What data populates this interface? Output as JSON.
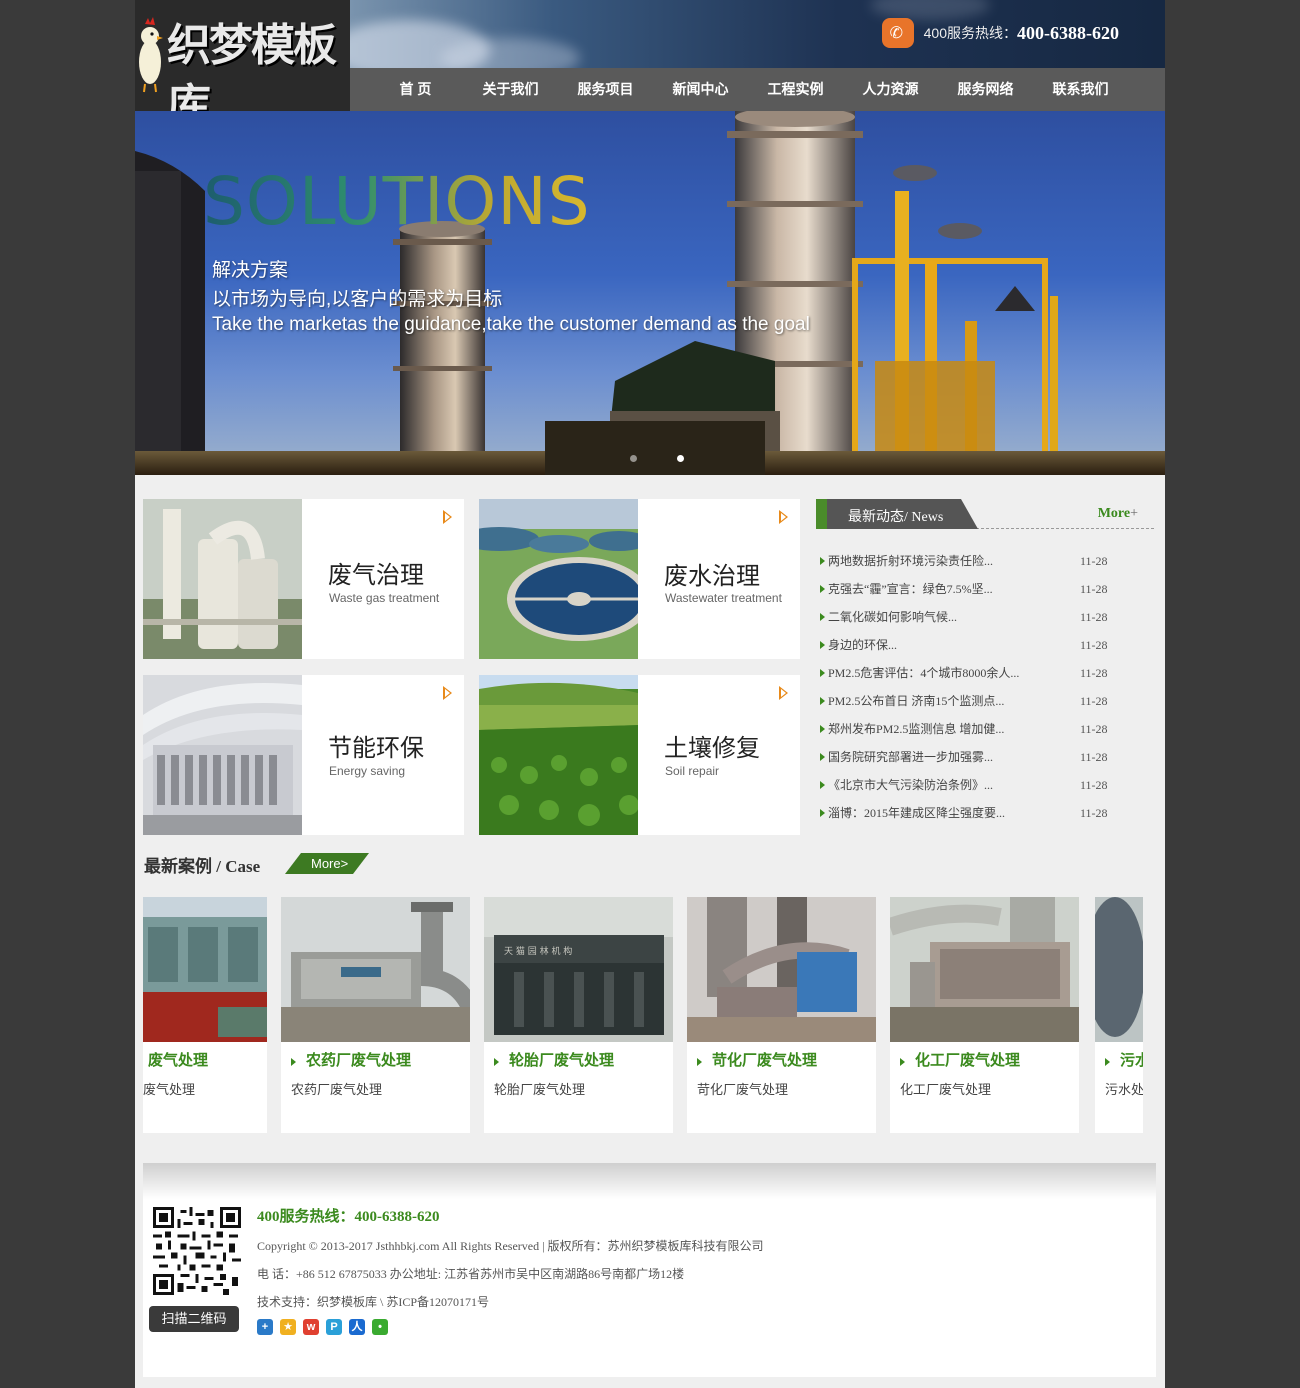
{
  "header": {
    "logo_text": "织梦模板库",
    "hotline_label": "400服务热线：",
    "hotline_number": "400-6388-620"
  },
  "nav": [
    {
      "label": "首 页"
    },
    {
      "label": "关于我们"
    },
    {
      "label": "服务项目"
    },
    {
      "label": "新闻中心"
    },
    {
      "label": "工程实例"
    },
    {
      "label": "人力资源"
    },
    {
      "label": "服务网络"
    },
    {
      "label": "联系我们"
    }
  ],
  "banner": {
    "title": "SOLUTIONS",
    "line1": "解决方案",
    "line2": "以市场为导向,以客户的需求为目标",
    "line3": "Take the marketas the guidance,take the customer demand as the goal",
    "active_slide": 2,
    "slide_count": 2
  },
  "services": [
    {
      "zh": "废气治理",
      "en": "Waste gas treatment"
    },
    {
      "zh": "废水治理",
      "en": "Wastewater treatment"
    },
    {
      "zh": "节能环保",
      "en": "Energy saving"
    },
    {
      "zh": "土壤修复",
      "en": "Soil repair"
    }
  ],
  "news": {
    "title": "最新动态/ News",
    "more": "More",
    "more_sign": "+",
    "items": [
      {
        "title": "两地数据折射环境污染责任险...",
        "date": "11-28"
      },
      {
        "title": "克强去“霾”宣言：绿色7.5%坚...",
        "date": "11-28"
      },
      {
        "title": "二氧化碳如何影响气候...",
        "date": "11-28"
      },
      {
        "title": "身边的环保...",
        "date": "11-28"
      },
      {
        "title": "PM2.5危害评估：4个城市8000余人...",
        "date": "11-28"
      },
      {
        "title": "PM2.5公布首日 济南15个监测点...",
        "date": "11-28"
      },
      {
        "title": "郑州发布PM2.5监测信息 增加健...",
        "date": "11-28"
      },
      {
        "title": "国务院研究部署进一步加强雾...",
        "date": "11-28"
      },
      {
        "title": "《北京市大气污染防治条例》...",
        "date": "11-28"
      },
      {
        "title": "淄博：2015年建成区降尘强度要...",
        "date": "11-28"
      }
    ]
  },
  "cases": {
    "title": "最新案例 / Case",
    "more": "More>",
    "items": [
      {
        "title": "废气处理",
        "desc": "废气处理"
      },
      {
        "title": "农药厂废气处理",
        "desc": "农药厂废气处理"
      },
      {
        "title": "轮胎厂废气处理",
        "desc": "轮胎厂废气处理"
      },
      {
        "title": "苛化厂废气处理",
        "desc": "苛化厂废气处理"
      },
      {
        "title": "化工厂废气处理",
        "desc": "化工厂废气处理"
      },
      {
        "title": "污水",
        "desc": "污水处"
      }
    ]
  },
  "footer": {
    "hotline": "400服务热线：400-6388-620",
    "copyright": "Copyright © 2013-2017 Jsthhbkj.com All Rights Reserved | 版权所有：苏州织梦模板库科技有限公司",
    "contact": "电 话：+86 512 67875033 办公地址: 江苏省苏州市吴中区南湖路86号南都广场12楼",
    "support": "技术支持：织梦模板库 \\ 苏ICP备12070171号",
    "scan_label": "扫描二维码"
  },
  "colors": {
    "accent_green": "#3b8a1e",
    "accent_orange": "#e88a1a",
    "nav_bg": "#5a5a5a",
    "page_bg": "#3a3a3a"
  },
  "icons": [
    "phone-icon",
    "arrow-icon",
    "qr-code",
    "share-plus-icon",
    "qzone-icon",
    "weibo-icon",
    "tencent-weibo-icon",
    "renren-icon",
    "wechat-icon"
  ]
}
